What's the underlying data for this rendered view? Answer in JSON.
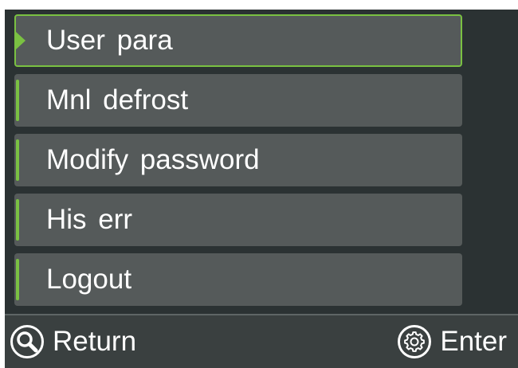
{
  "menu": {
    "items": [
      {
        "label": "User  para",
        "selected": true
      },
      {
        "label": "Mnl  defrost",
        "selected": false
      },
      {
        "label": "Modify  password",
        "selected": false
      },
      {
        "label": "His  err",
        "selected": false
      },
      {
        "label": "Logout",
        "selected": false
      }
    ]
  },
  "footer": {
    "return_label": "Return",
    "return_icon": "search-icon",
    "enter_label": "Enter",
    "enter_icon": "gear-icon"
  },
  "colors": {
    "accent": "#7ac142",
    "background": "#2b3233",
    "item": "#555a5a",
    "text": "#ffffff"
  }
}
